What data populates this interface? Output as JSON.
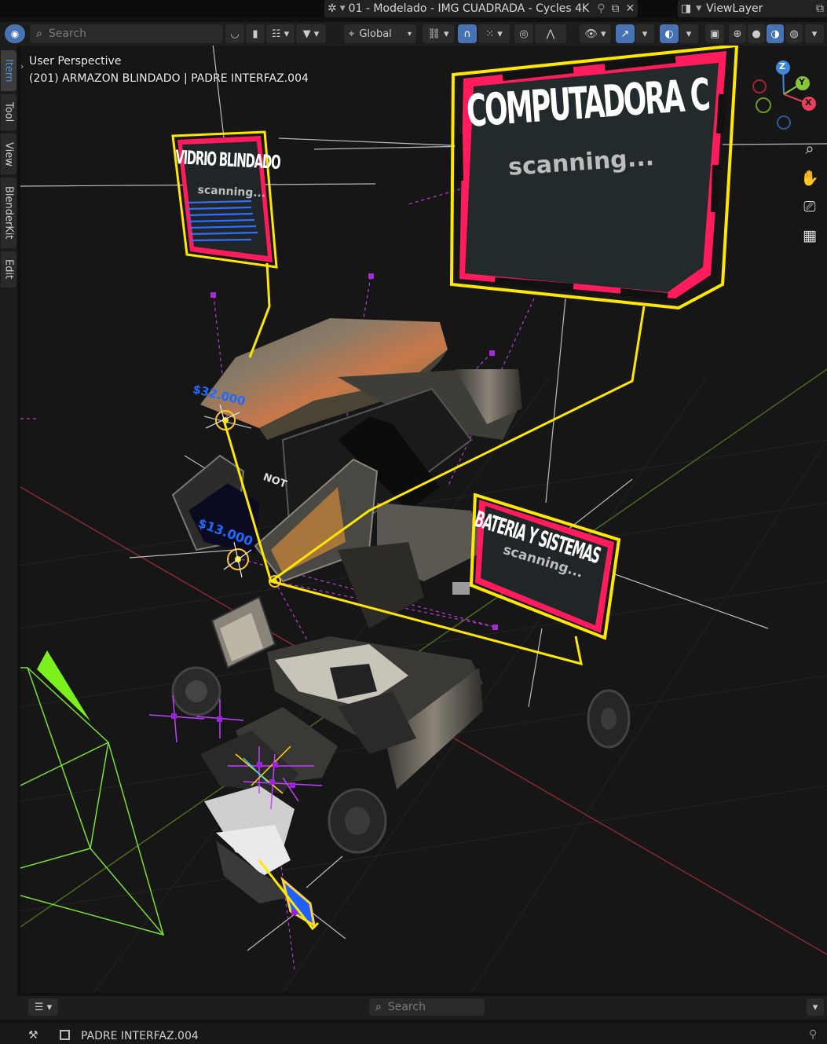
{
  "top": {
    "scene": "01 - Modelado - IMG CUADRADA - Cycles 4K",
    "view_layer": "ViewLayer"
  },
  "header": {
    "search_placeholder": "Search",
    "orientation": "Global"
  },
  "sidebar_tabs": [
    "Item",
    "Tool",
    "View",
    "BlenderKit",
    "Edit"
  ],
  "viewport": {
    "mode_label": "User Perspective",
    "object_label": "(201) ARMAZON BLINDADO | PADRE INTERFAZ.004",
    "panel_main_title": "COMPUTADORA C",
    "panel_main_sub": "scanning...",
    "panel_left_title": "VIDRIO BLINDADO",
    "panel_left_sub": "scanning...",
    "panel_right_title": "BATERIA Y SISTEMAS",
    "panel_right_sub": "scanning...",
    "price1": "$32.000",
    "price2": "$13.000",
    "label_hidden": "NOT"
  },
  "gizmo": {
    "z": "Z",
    "y": "Y",
    "x": "X"
  },
  "bottom": {
    "search_placeholder": "Search",
    "status_item": "PADRE INTERFAZ.004"
  },
  "colors": {
    "accent": "#4772b3",
    "panel_frame": "#ffe800",
    "panel_stripe": "#ff1c5c",
    "axis_x": "#e8405a",
    "axis_y": "#8ac534",
    "axis_z": "#3d88d8"
  }
}
